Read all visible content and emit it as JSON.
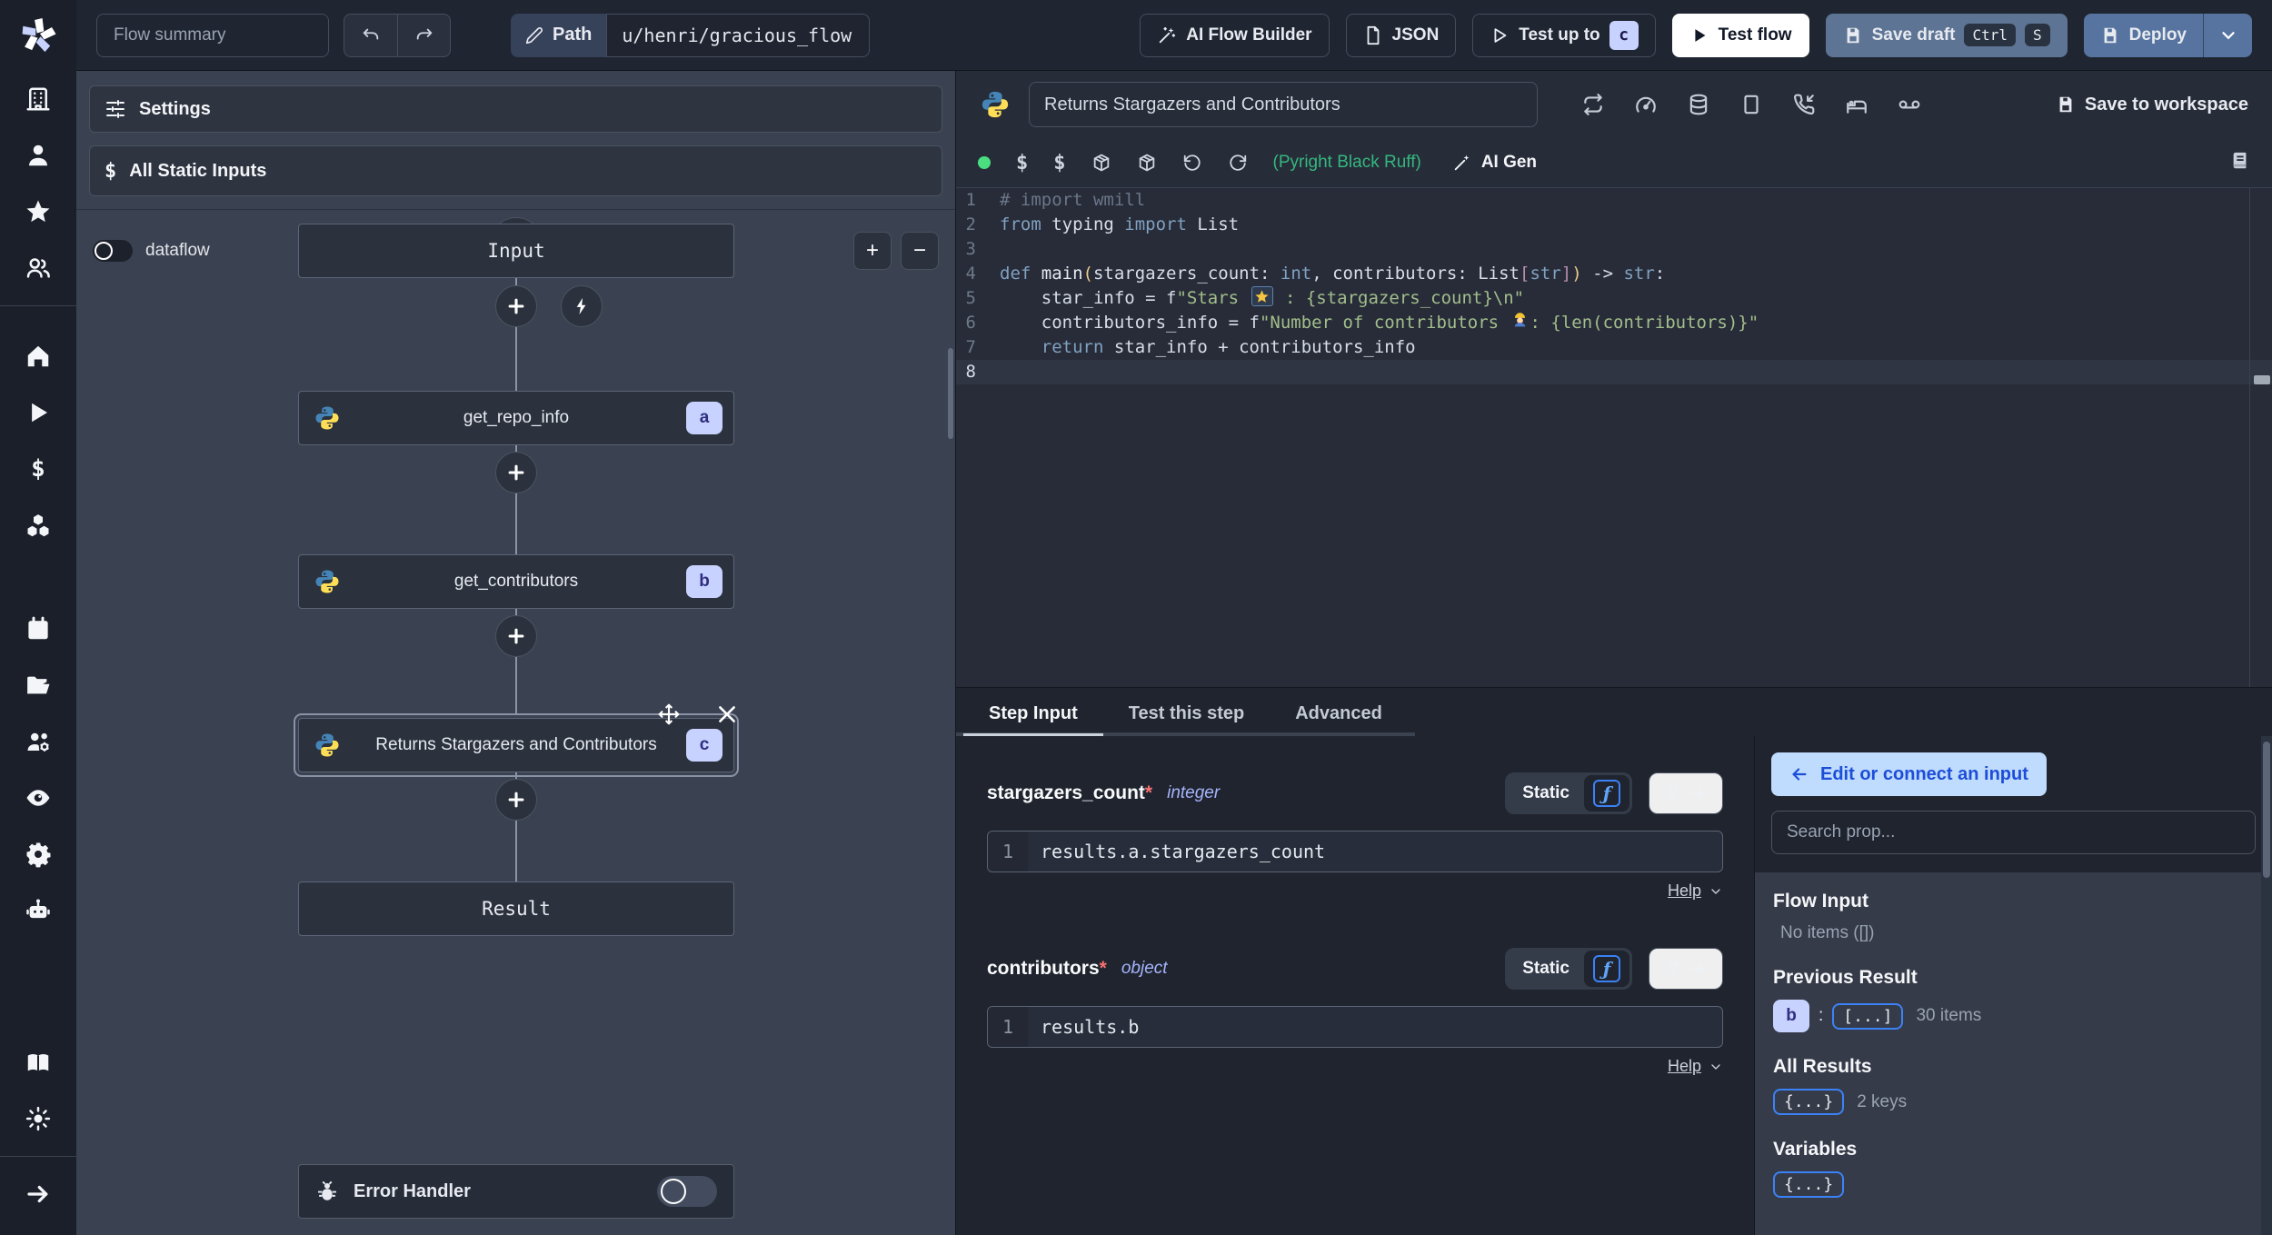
{
  "topbar": {
    "flow_summary": "Flow summary",
    "path_label": "Path",
    "path_value": "u/henri/gracious_flow",
    "ai_flow_builder": "AI Flow Builder",
    "json_btn": "JSON",
    "test_up_to": "Test up to",
    "test_up_to_badge": "c",
    "test_flow": "Test flow",
    "save_draft": "Save draft",
    "save_draft_kbd": [
      "Ctrl",
      "S"
    ],
    "deploy": "Deploy"
  },
  "sidebar": {
    "groups": [
      [
        "building",
        "user",
        "star",
        "users"
      ],
      [
        "home",
        "play",
        "dollar",
        "boxes"
      ],
      [
        "calendar",
        "folder-open",
        "users-cog",
        "eye",
        "gear",
        "bot"
      ]
    ],
    "bottom": [
      "book",
      "sun"
    ],
    "footer": [
      "arrow-right"
    ]
  },
  "flow_panel": {
    "settings": "Settings",
    "all_static_inputs": "All Static Inputs",
    "dataflow_label": "dataflow",
    "zoom_in": "+",
    "zoom_out": "−",
    "graph": {
      "input_node": "Input",
      "result_node": "Result",
      "steps": [
        {
          "label": "get_repo_info",
          "badge": "a",
          "selected": false
        },
        {
          "label": "get_contributors",
          "badge": "b",
          "selected": false
        },
        {
          "label": "Returns Stargazers and Contributors",
          "badge": "c",
          "selected": true
        }
      ],
      "error_handler": "Error Handler"
    }
  },
  "editor": {
    "title": "Returns Stargazers and Contributors",
    "header_icons": [
      "repeat",
      "gauge",
      "database",
      "square",
      "phone-incoming",
      "bed",
      "voicemail"
    ],
    "save_to_workspace": "Save to workspace",
    "toolbar_icons": [
      "dollar",
      "dollar",
      "package",
      "package",
      "rotate-ccw",
      "rotate-cw"
    ],
    "assistants": "(Pyright Black Ruff)",
    "ai_gen": "AI Gen",
    "code_lines": [
      {
        "n": "1",
        "tokens": [
          {
            "s": "# import wmill",
            "c": "c"
          }
        ]
      },
      {
        "n": "2",
        "tokens": [
          {
            "s": "from",
            "c": "k"
          },
          {
            "s": " typing ",
            "c": "p"
          },
          {
            "s": "import",
            "c": "k"
          },
          {
            "s": " List",
            "c": "p"
          }
        ]
      },
      {
        "n": "3",
        "tokens": []
      },
      {
        "n": "4",
        "tokens": [
          {
            "s": "def ",
            "c": "k"
          },
          {
            "s": "main",
            "c": "fn"
          },
          {
            "s": "(",
            "c": "y"
          },
          {
            "s": "stargazers_count: ",
            "c": "p"
          },
          {
            "s": "int",
            "c": "t"
          },
          {
            "s": ", contributors: List",
            "c": "p"
          },
          {
            "s": "[",
            "c": "m"
          },
          {
            "s": "str",
            "c": "t"
          },
          {
            "s": "]",
            "c": "m"
          },
          {
            "s": ")",
            "c": "y"
          },
          {
            "s": " -> ",
            "c": "p"
          },
          {
            "s": "str",
            "c": "t"
          },
          {
            "s": ":",
            "c": "p"
          }
        ]
      },
      {
        "n": "5",
        "tokens": [
          {
            "s": "    star_info = f",
            "c": "p"
          },
          {
            "s": "\"Stars ",
            "c": "s"
          },
          {
            "s": "⭐",
            "c": "emoji-star"
          },
          {
            "s": " : {stargazers_count}\\n\"",
            "c": "s"
          }
        ]
      },
      {
        "n": "6",
        "tokens": [
          {
            "s": "    contributors_info = f",
            "c": "p"
          },
          {
            "s": "\"Number of contributors ",
            "c": "s"
          },
          {
            "s": "👷",
            "c": "emoji-worker"
          },
          {
            "s": ": {len(contributors)}\"",
            "c": "s"
          }
        ]
      },
      {
        "n": "7",
        "tokens": [
          {
            "s": "    ",
            "c": "p"
          },
          {
            "s": "return",
            "c": "k"
          },
          {
            "s": " star_info + contributors_info",
            "c": "p"
          }
        ]
      },
      {
        "n": "8",
        "tokens": [],
        "current": true
      }
    ]
  },
  "step_panel": {
    "tabs": [
      "Step Input",
      "Test this step",
      "Advanced"
    ],
    "active_tab": "Step Input",
    "fields": [
      {
        "name": "stargazers_count",
        "required": "*",
        "type": "integer",
        "mode": "Static",
        "line_no": "1",
        "expr": "results.a.stargazers_count",
        "help": "Help"
      },
      {
        "name": "contributors",
        "required": "*",
        "type": "object",
        "mode": "Static",
        "line_no": "1",
        "expr": "results.b",
        "help": "Help"
      }
    ]
  },
  "props_panel": {
    "edit_connect": "Edit or connect an input",
    "search_placeholder": "Search prop...",
    "sections": [
      {
        "title": "Flow Input",
        "empty": "No items ([])"
      },
      {
        "title": "Previous Result",
        "badge": "b",
        "colon": ":",
        "chip": "[...]",
        "meta": "30 items"
      },
      {
        "title": "All Results",
        "chip": "{...}",
        "meta": "2 keys"
      },
      {
        "title": "Variables",
        "chip": "{...}",
        "meta": ""
      }
    ]
  },
  "colors": {
    "accent_lavender": "#c7d2fe",
    "accent_blue": "#3b82f6",
    "connect_button_bg": "#bfdbfe",
    "connect_button_text": "#1d4ed8",
    "run_green": "#4ade80",
    "assistant_green": "#35b77f",
    "deploy_blue": "#56749f",
    "save_draft_slate": "#5d7494"
  }
}
